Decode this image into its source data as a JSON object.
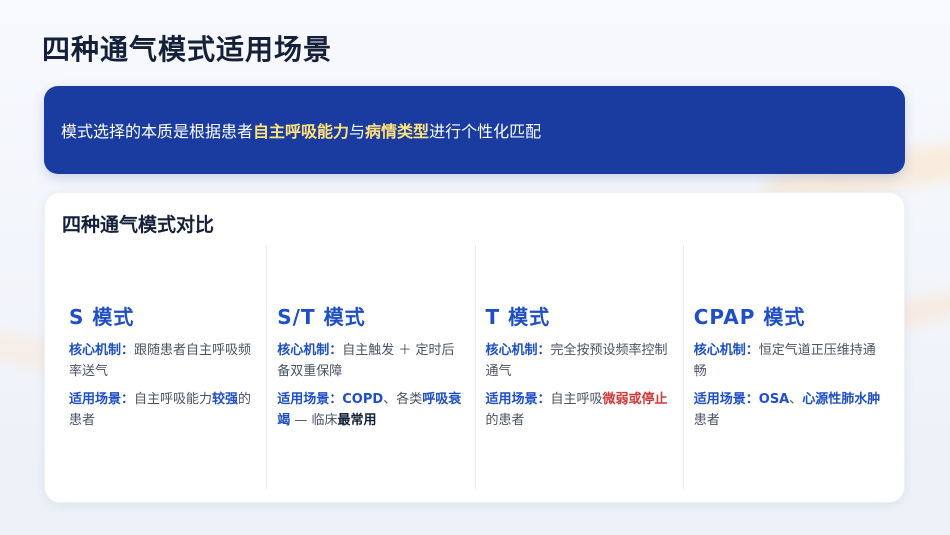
{
  "page": {
    "title": "四种通气模式适用场景"
  },
  "banner": {
    "prefix": "模式选择的本质是根据患者",
    "highlight1": "自主呼吸能力",
    "connector": "与",
    "highlight2": "病情类型",
    "suffix": "进行个性化匹配"
  },
  "comparison": {
    "title": "四种通气模式对比",
    "modes": [
      {
        "name": "S  模式",
        "mech_label": "核心机制：",
        "mech_text": "跟随患者自主呼吸频率送气",
        "scene_label": "适用场景：",
        "scene_text1": "自主呼吸能力",
        "scene_em": "较强",
        "scene_text2": "的患者"
      },
      {
        "name": "S/T  模式",
        "mech_label": "核心机制：",
        "mech_text": "自主触发 ＋ 定时后备双重保障",
        "scene_label": "适用场景：",
        "scene_em1": "COPD",
        "scene_text1": "、各类",
        "scene_em2": "呼吸衰竭",
        "scene_text2": " — 临床",
        "scene_em3": "最常用"
      },
      {
        "name": "T  模式",
        "mech_label": "核心机制：",
        "mech_text": "完全按预设频率控制通气",
        "scene_label": "适用场景：",
        "scene_text1": "自主呼吸",
        "scene_em": "微弱或停止",
        "scene_text2": "的患者"
      },
      {
        "name": "CPAP  模式",
        "mech_label": "核心机制：",
        "mech_text": "恒定气道正压维持通畅",
        "scene_label": "适用场景：",
        "scene_em1": "OSA",
        "scene_text1": "、",
        "scene_em2": "心源性肺水肿",
        "scene_text2": "患者"
      }
    ]
  },
  "colors": {
    "banner_bg": "#1a3b9f",
    "banner_highlight": "#ffe27a",
    "accent_blue": "#1f4fc6",
    "accent_red": "#d23a3a",
    "title_text": "#15203a"
  }
}
